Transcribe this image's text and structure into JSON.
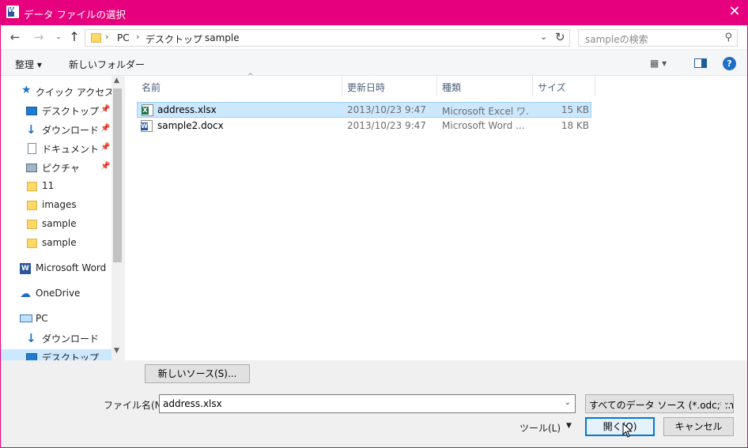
{
  "window": {
    "title": "データ ファイルの選択",
    "close": "✕"
  },
  "address": {
    "crumbs": [
      "PC",
      "デスクトップ",
      "sample"
    ],
    "separator": "›"
  },
  "search": {
    "placeholder": "sampleの検索"
  },
  "toolbar": {
    "organize": "整理 ▾",
    "new_folder": "新しいフォルダー",
    "view": "▦ ▾",
    "help": "?"
  },
  "nav": {
    "items": [
      {
        "label": "クイック アクセス"
      },
      {
        "label": "デスクトップ"
      },
      {
        "label": "ダウンロード"
      },
      {
        "label": "ドキュメント"
      },
      {
        "label": "ピクチャ"
      },
      {
        "label": "11"
      },
      {
        "label": "images"
      },
      {
        "label": "sample"
      },
      {
        "label": "sample"
      },
      {
        "label": "Microsoft Word"
      },
      {
        "label": "OneDrive"
      },
      {
        "label": "PC"
      },
      {
        "label": "ダウンロード"
      },
      {
        "label": "デスクトップ"
      }
    ]
  },
  "columns": [
    "名前",
    "更新日時",
    "種類",
    "サイズ"
  ],
  "files": [
    {
      "name": "address.xlsx",
      "date": "2013/10/23 9:47",
      "type": "Microsoft Excel ワ...",
      "size": "15 KB",
      "badge": "X"
    },
    {
      "name": "sample2.docx",
      "date": "2013/10/23 9:47",
      "type": "Microsoft Word ...",
      "size": "18 KB",
      "badge": "W"
    }
  ],
  "bottom": {
    "new_source": "新しいソース(S)...",
    "filename_label": "ファイル名(N):",
    "filename_value": "address.xlsx",
    "filter": "すべてのデータ ソース (*.odc;*.mdb;",
    "tools": "ツール(L)",
    "open": "開く(O)",
    "cancel": "キャンセル"
  },
  "colors": {
    "accent": "#e6007e",
    "selection": "#cce8ff"
  }
}
